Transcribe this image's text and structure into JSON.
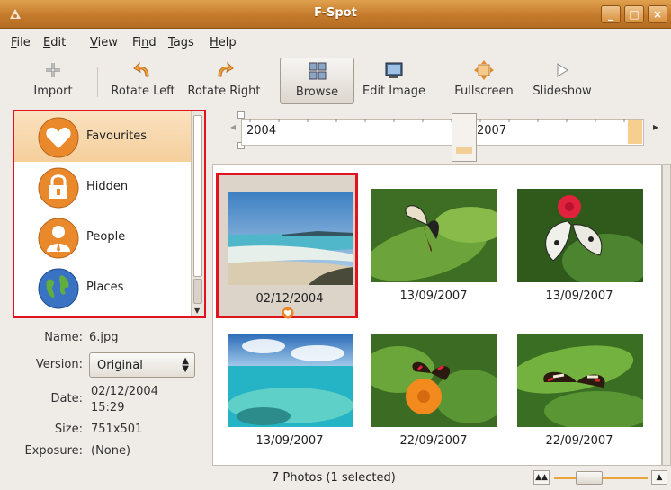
{
  "window": {
    "title": "F-Spot"
  },
  "menu": [
    {
      "label": "File",
      "u": "F",
      "rest": "ile"
    },
    {
      "label": "Edit",
      "u": "E",
      "rest": "dit"
    },
    {
      "label": "View",
      "u": "V",
      "rest": "iew"
    },
    {
      "label": "Find",
      "u": "",
      "rest": "Fi",
      "u2": "n",
      "rest2": "d"
    },
    {
      "label": "Tags",
      "u": "T",
      "rest": "ags"
    },
    {
      "label": "Help",
      "u": "H",
      "rest": "elp"
    }
  ],
  "toolbar": {
    "import": "Import",
    "rotate_left": "Rotate Left",
    "rotate_right": "Rotate Right",
    "browse": "Browse",
    "edit_image": "Edit Image",
    "fullscreen": "Fullscreen",
    "slideshow": "Slideshow"
  },
  "tags": [
    {
      "label": "Favourites",
      "icon": "heart-icon",
      "selected": true
    },
    {
      "label": "Hidden",
      "icon": "lock-icon",
      "selected": false
    },
    {
      "label": "People",
      "icon": "person-icon",
      "selected": false
    },
    {
      "label": "Places",
      "icon": "globe-icon",
      "selected": false
    }
  ],
  "info": {
    "name_key": "Name:",
    "name_val": "6.jpg",
    "version_key": "Version:",
    "version_val": "Original",
    "date_key": "Date:",
    "date_val_line1": "02/12/2004",
    "date_val_line2": "15:29",
    "size_key": "Size:",
    "size_val": "751x501",
    "exposure_key": "Exposure:",
    "exposure_val": "(None)"
  },
  "timeline": {
    "start_label": "2004",
    "end_label": "2007"
  },
  "photos": [
    {
      "date": "02/12/2004",
      "subject": "beach",
      "selected": true,
      "favourite": true
    },
    {
      "date": "13/09/2007",
      "subject": "butterfly-leaf",
      "selected": false
    },
    {
      "date": "13/09/2007",
      "subject": "butterfly-red-flower",
      "selected": false
    },
    {
      "date": "13/09/2007",
      "subject": "ocean-reef",
      "selected": false
    },
    {
      "date": "22/09/2007",
      "subject": "butterfly-orange-flower",
      "selected": false
    },
    {
      "date": "22/09/2007",
      "subject": "butterfly-green-leaf",
      "selected": false
    }
  ],
  "status": {
    "text": "7 Photos (1 selected)"
  },
  "colors": {
    "accent": "#e8a53c",
    "selection": "#e0141e",
    "titlebar": "#c47a2b"
  }
}
